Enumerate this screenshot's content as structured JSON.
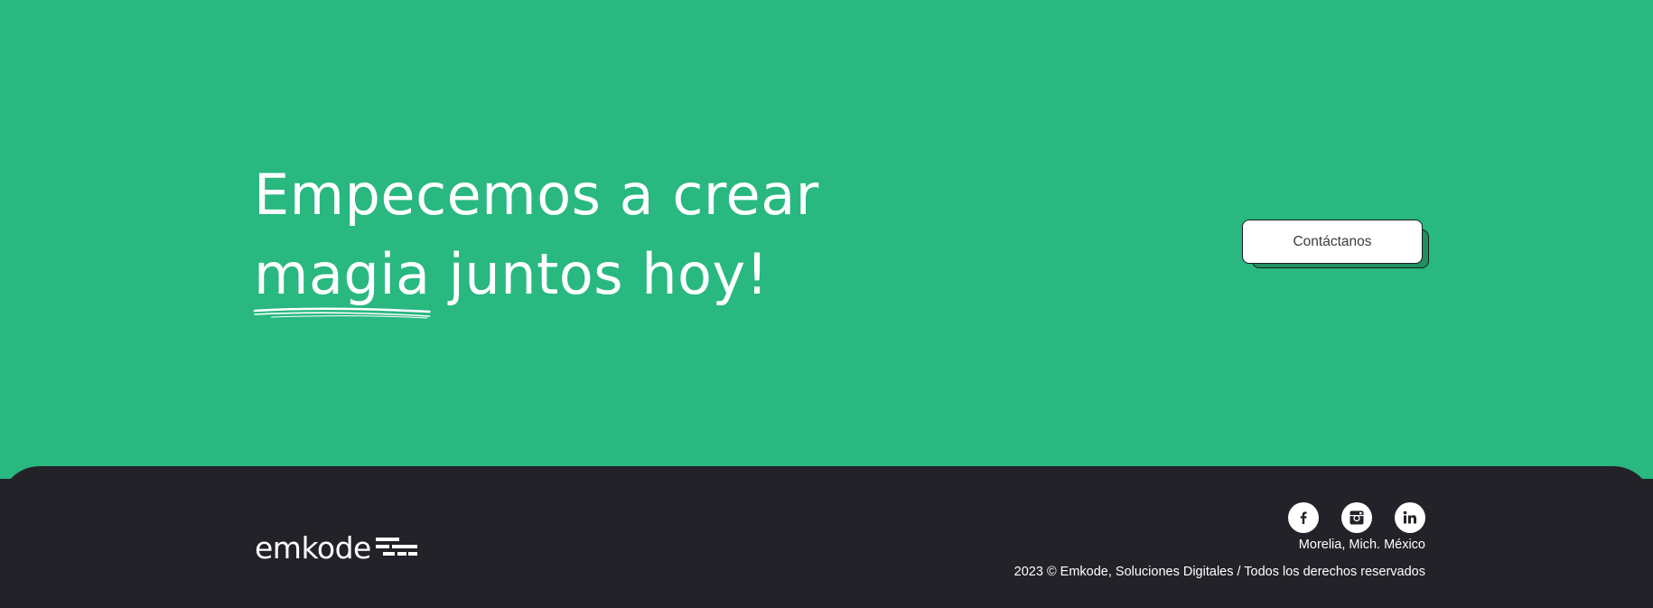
{
  "colors": {
    "cta_background": "#28b880",
    "footer_background": "#232228",
    "button_shadow": "#21905f",
    "text_light": "#ffffff"
  },
  "cta": {
    "headline_line1": "Empecemos a crear",
    "headline_highlight": "magia",
    "headline_line2_rest": " juntos hoy!",
    "contact_button_label": "Contáctanos"
  },
  "footer": {
    "logo_text": "emkode",
    "social": [
      {
        "icon": "facebook-icon",
        "glyph": "f"
      },
      {
        "icon": "instagram-icon",
        "glyph": ""
      },
      {
        "icon": "linkedin-icon",
        "glyph": "in"
      }
    ],
    "location": "Morelia, Mich. México",
    "copyright": "2023 © Emkode, Soluciones Digitales / Todos los derechos reservados"
  }
}
